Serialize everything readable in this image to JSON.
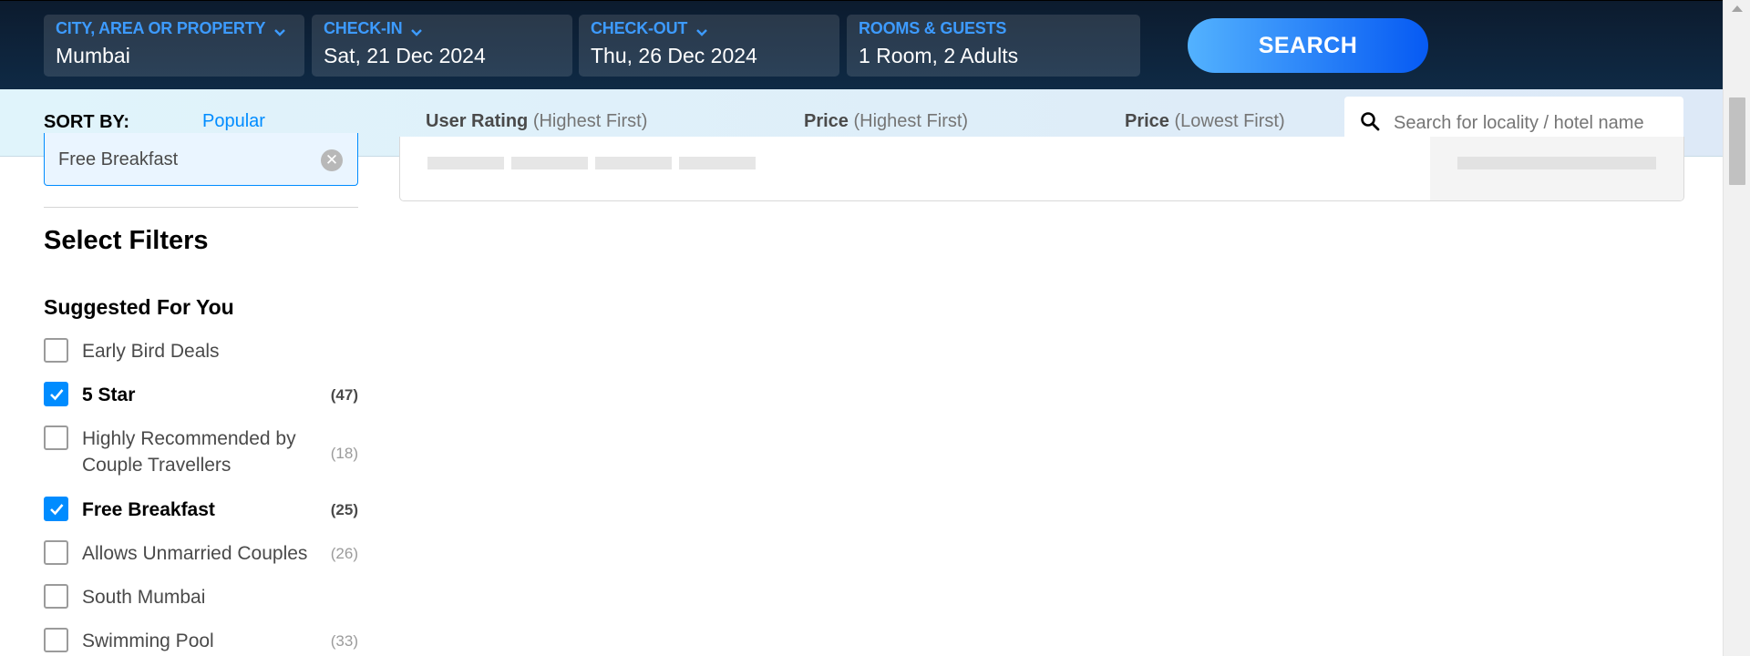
{
  "header": {
    "city": {
      "label": "CITY, AREA OR PROPERTY",
      "value": "Mumbai",
      "icon": "chevron-down-icon"
    },
    "checkin": {
      "label": "CHECK-IN",
      "value": "Sat, 21 Dec 2024",
      "icon": "chevron-down-icon"
    },
    "checkout": {
      "label": "CHECK-OUT",
      "value": "Thu, 26 Dec 2024",
      "icon": "chevron-down-icon"
    },
    "rooms": {
      "label": "ROOMS & GUESTS",
      "value": "1 Room, 2 Adults"
    },
    "search_label": "SEARCH"
  },
  "sort": {
    "label": "SORT BY:",
    "options": [
      {
        "main": "Popular",
        "sub": "",
        "selected": true
      },
      {
        "main": "User Rating",
        "sub": "(Highest First)",
        "selected": false
      },
      {
        "main": "Price",
        "sub": "(Highest First)",
        "selected": false
      },
      {
        "main": "Price",
        "sub": "(Lowest First)",
        "selected": false
      }
    ],
    "locality_placeholder": "Search for locality / hotel name"
  },
  "applied_filter": {
    "label": "Free Breakfast",
    "remove_icon": "close-icon"
  },
  "filters": {
    "title": "Select Filters",
    "section_title": "Suggested For You",
    "items": [
      {
        "label": "Early Bird Deals",
        "count": "",
        "checked": false
      },
      {
        "label": "5 Star",
        "count": "(47)",
        "checked": true
      },
      {
        "label": "Highly Recommended by Couple Travellers",
        "count": "(18)",
        "checked": false
      },
      {
        "label": "Free Breakfast",
        "count": "(25)",
        "checked": true
      },
      {
        "label": "Allows Unmarried Couples",
        "count": "(26)",
        "checked": false
      },
      {
        "label": "South Mumbai",
        "count": "",
        "checked": false
      },
      {
        "label": "Swimming Pool",
        "count": "(33)",
        "checked": false
      }
    ]
  },
  "colors": {
    "accent": "#008cff",
    "header_bg": "#0c1b2e",
    "field_label": "#3d9bff",
    "sortbar_bg": "#e0f4fb"
  }
}
